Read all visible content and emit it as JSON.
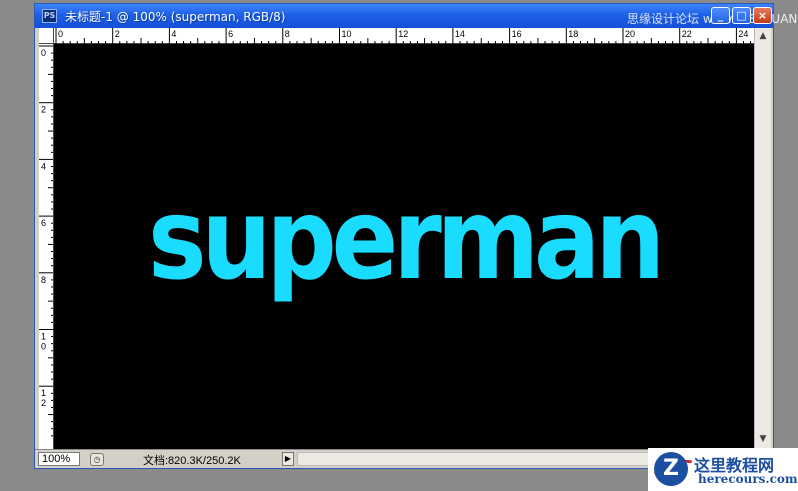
{
  "window": {
    "app_icon": "PS",
    "title": "未标题-1 @ 100% (superman, RGB/8)",
    "buttons": {
      "minimize": "_",
      "maximize": "□",
      "close": "×"
    }
  },
  "watermark_top": "思缘设计论坛 www.MISSYUAN.com",
  "ruler": {
    "top_labels": [
      "0",
      "2",
      "4",
      "6",
      "8",
      "10",
      "12",
      "14",
      "16",
      "18",
      "20",
      "22",
      "24"
    ],
    "left_labels": [
      "0",
      "2",
      "4",
      "6",
      "8",
      "1\n0",
      "1\n2"
    ]
  },
  "canvas": {
    "background": "#000000",
    "text": "superman",
    "text_color": "#19dcff"
  },
  "status": {
    "zoom": "100%",
    "doc_size": "文档:820.3K/250.2K",
    "arrow": "▶"
  },
  "brand": {
    "logo_letter": "Z",
    "name": "这里教程网",
    "url": "herecours.com"
  }
}
